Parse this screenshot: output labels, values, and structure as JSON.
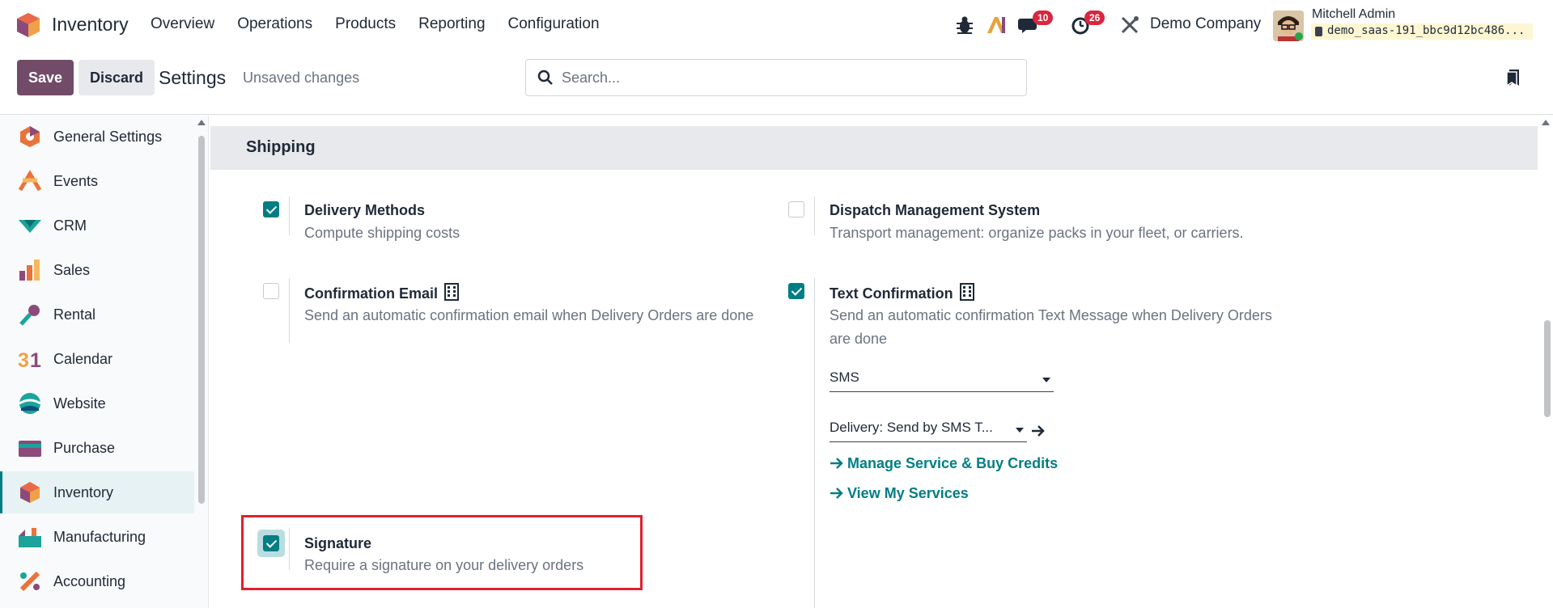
{
  "navbar": {
    "app_name": "Inventory",
    "menu": [
      "Overview",
      "Operations",
      "Products",
      "Reporting",
      "Configuration"
    ],
    "messages_badge": "10",
    "activities_badge": "26",
    "company": "Demo Company",
    "user_name": "Mitchell Admin",
    "database": "demo_saas-191_bbc9d12bc486..."
  },
  "control": {
    "save_label": "Save",
    "discard_label": "Discard",
    "title": "Settings",
    "status": "Unsaved changes",
    "search_placeholder": "Search..."
  },
  "sidebar": {
    "items": [
      {
        "label": "General Settings",
        "icon": "general-settings-icon"
      },
      {
        "label": "Events",
        "icon": "events-icon"
      },
      {
        "label": "CRM",
        "icon": "crm-icon"
      },
      {
        "label": "Sales",
        "icon": "sales-icon"
      },
      {
        "label": "Rental",
        "icon": "rental-icon"
      },
      {
        "label": "Calendar",
        "icon": "calendar-icon"
      },
      {
        "label": "Website",
        "icon": "website-icon"
      },
      {
        "label": "Purchase",
        "icon": "purchase-icon"
      },
      {
        "label": "Inventory",
        "icon": "inventory-icon",
        "active": true
      },
      {
        "label": "Manufacturing",
        "icon": "manufacturing-icon"
      },
      {
        "label": "Accounting",
        "icon": "accounting-icon"
      }
    ]
  },
  "section": {
    "title": "Shipping",
    "settings": {
      "delivery_methods": {
        "title": "Delivery Methods",
        "desc": "Compute shipping costs",
        "checked": true
      },
      "dispatch": {
        "title": "Dispatch Management System",
        "desc": "Transport management: organize packs in your fleet, or carriers.",
        "checked": false
      },
      "confirmation_email": {
        "title": "Confirmation Email",
        "desc": "Send an automatic confirmation email when Delivery Orders are done",
        "checked": false
      },
      "text_confirmation": {
        "title": "Text Confirmation",
        "desc": "Send an automatic confirmation Text Message when Delivery Orders are done",
        "checked": true,
        "channel": "SMS",
        "template": "Delivery: Send by SMS T...",
        "link_credits": "Manage Service & Buy Credits",
        "link_services": "View My Services"
      },
      "signature": {
        "title": "Signature",
        "desc": "Require a signature on your delivery orders",
        "checked": true
      }
    }
  },
  "colors": {
    "accent": "#017e84",
    "primary": "#714b67",
    "badge": "#d9263f",
    "highlight": "#e0202f"
  }
}
